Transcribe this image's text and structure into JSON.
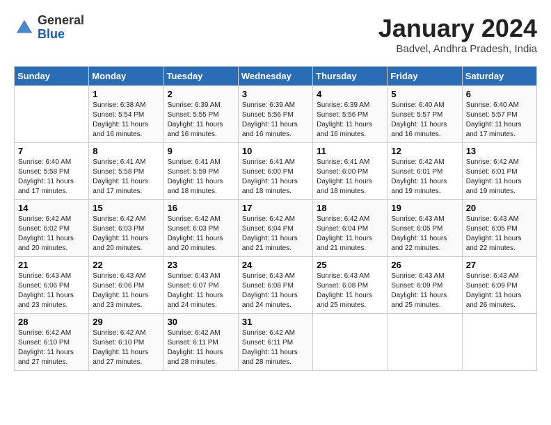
{
  "header": {
    "logo_general": "General",
    "logo_blue": "Blue",
    "month_year": "January 2024",
    "location": "Badvel, Andhra Pradesh, India"
  },
  "weekdays": [
    "Sunday",
    "Monday",
    "Tuesday",
    "Wednesday",
    "Thursday",
    "Friday",
    "Saturday"
  ],
  "weeks": [
    [
      {
        "day": "",
        "content": ""
      },
      {
        "day": "1",
        "content": "Sunrise: 6:38 AM\nSunset: 5:54 PM\nDaylight: 11 hours and 16 minutes."
      },
      {
        "day": "2",
        "content": "Sunrise: 6:39 AM\nSunset: 5:55 PM\nDaylight: 11 hours and 16 minutes."
      },
      {
        "day": "3",
        "content": "Sunrise: 6:39 AM\nSunset: 5:56 PM\nDaylight: 11 hours and 16 minutes."
      },
      {
        "day": "4",
        "content": "Sunrise: 6:39 AM\nSunset: 5:56 PM\nDaylight: 11 hours and 16 minutes."
      },
      {
        "day": "5",
        "content": "Sunrise: 6:40 AM\nSunset: 5:57 PM\nDaylight: 11 hours and 16 minutes."
      },
      {
        "day": "6",
        "content": "Sunrise: 6:40 AM\nSunset: 5:57 PM\nDaylight: 11 hours and 17 minutes."
      }
    ],
    [
      {
        "day": "7",
        "content": "Sunrise: 6:40 AM\nSunset: 5:58 PM\nDaylight: 11 hours and 17 minutes."
      },
      {
        "day": "8",
        "content": "Sunrise: 6:41 AM\nSunset: 5:58 PM\nDaylight: 11 hours and 17 minutes."
      },
      {
        "day": "9",
        "content": "Sunrise: 6:41 AM\nSunset: 5:59 PM\nDaylight: 11 hours and 18 minutes."
      },
      {
        "day": "10",
        "content": "Sunrise: 6:41 AM\nSunset: 6:00 PM\nDaylight: 11 hours and 18 minutes."
      },
      {
        "day": "11",
        "content": "Sunrise: 6:41 AM\nSunset: 6:00 PM\nDaylight: 11 hours and 18 minutes."
      },
      {
        "day": "12",
        "content": "Sunrise: 6:42 AM\nSunset: 6:01 PM\nDaylight: 11 hours and 19 minutes."
      },
      {
        "day": "13",
        "content": "Sunrise: 6:42 AM\nSunset: 6:01 PM\nDaylight: 11 hours and 19 minutes."
      }
    ],
    [
      {
        "day": "14",
        "content": "Sunrise: 6:42 AM\nSunset: 6:02 PM\nDaylight: 11 hours and 20 minutes."
      },
      {
        "day": "15",
        "content": "Sunrise: 6:42 AM\nSunset: 6:03 PM\nDaylight: 11 hours and 20 minutes."
      },
      {
        "day": "16",
        "content": "Sunrise: 6:42 AM\nSunset: 6:03 PM\nDaylight: 11 hours and 20 minutes."
      },
      {
        "day": "17",
        "content": "Sunrise: 6:42 AM\nSunset: 6:04 PM\nDaylight: 11 hours and 21 minutes."
      },
      {
        "day": "18",
        "content": "Sunrise: 6:42 AM\nSunset: 6:04 PM\nDaylight: 11 hours and 21 minutes."
      },
      {
        "day": "19",
        "content": "Sunrise: 6:43 AM\nSunset: 6:05 PM\nDaylight: 11 hours and 22 minutes."
      },
      {
        "day": "20",
        "content": "Sunrise: 6:43 AM\nSunset: 6:05 PM\nDaylight: 11 hours and 22 minutes."
      }
    ],
    [
      {
        "day": "21",
        "content": "Sunrise: 6:43 AM\nSunset: 6:06 PM\nDaylight: 11 hours and 23 minutes."
      },
      {
        "day": "22",
        "content": "Sunrise: 6:43 AM\nSunset: 6:06 PM\nDaylight: 11 hours and 23 minutes."
      },
      {
        "day": "23",
        "content": "Sunrise: 6:43 AM\nSunset: 6:07 PM\nDaylight: 11 hours and 24 minutes."
      },
      {
        "day": "24",
        "content": "Sunrise: 6:43 AM\nSunset: 6:08 PM\nDaylight: 11 hours and 24 minutes."
      },
      {
        "day": "25",
        "content": "Sunrise: 6:43 AM\nSunset: 6:08 PM\nDaylight: 11 hours and 25 minutes."
      },
      {
        "day": "26",
        "content": "Sunrise: 6:43 AM\nSunset: 6:09 PM\nDaylight: 11 hours and 25 minutes."
      },
      {
        "day": "27",
        "content": "Sunrise: 6:43 AM\nSunset: 6:09 PM\nDaylight: 11 hours and 26 minutes."
      }
    ],
    [
      {
        "day": "28",
        "content": "Sunrise: 6:42 AM\nSunset: 6:10 PM\nDaylight: 11 hours and 27 minutes."
      },
      {
        "day": "29",
        "content": "Sunrise: 6:42 AM\nSunset: 6:10 PM\nDaylight: 11 hours and 27 minutes."
      },
      {
        "day": "30",
        "content": "Sunrise: 6:42 AM\nSunset: 6:11 PM\nDaylight: 11 hours and 28 minutes."
      },
      {
        "day": "31",
        "content": "Sunrise: 6:42 AM\nSunset: 6:11 PM\nDaylight: 11 hours and 28 minutes."
      },
      {
        "day": "",
        "content": ""
      },
      {
        "day": "",
        "content": ""
      },
      {
        "day": "",
        "content": ""
      }
    ]
  ]
}
